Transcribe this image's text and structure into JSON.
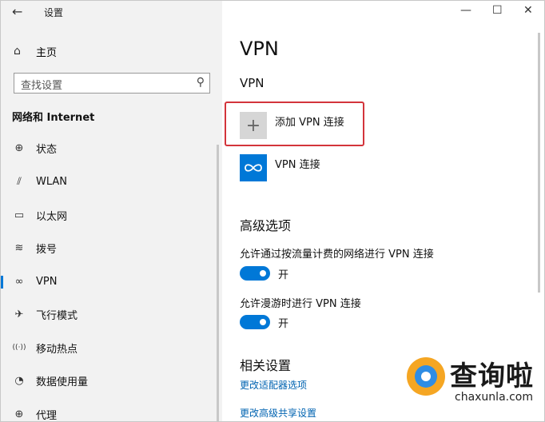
{
  "window": {
    "title": "设置",
    "back_glyph": "←",
    "minimize_glyph": "—",
    "maximize_glyph": "☐",
    "close_glyph": "✕"
  },
  "sidebar": {
    "home_label": "主页",
    "search_placeholder": "查找设置",
    "section_title": "网络和 Internet",
    "items": [
      {
        "label": "状态",
        "icon": "globe-icon",
        "glyph": "⊕"
      },
      {
        "label": "WLAN",
        "icon": "wifi-icon",
        "glyph": "⫽"
      },
      {
        "label": "以太网",
        "icon": "ethernet-icon",
        "glyph": "▭"
      },
      {
        "label": "拨号",
        "icon": "dialup-icon",
        "glyph": "≋"
      },
      {
        "label": "VPN",
        "icon": "vpn-icon",
        "glyph": "∞",
        "active": true
      },
      {
        "label": "飞行模式",
        "icon": "airplane-icon",
        "glyph": "✈"
      },
      {
        "label": "移动热点",
        "icon": "hotspot-icon",
        "glyph": "((·))"
      },
      {
        "label": "数据使用量",
        "icon": "data-usage-icon",
        "glyph": "◔"
      },
      {
        "label": "代理",
        "icon": "proxy-icon",
        "glyph": "⊕"
      }
    ]
  },
  "main": {
    "page_title": "VPN",
    "vpn_section_title": "VPN",
    "add_vpn_label": "添加 VPN 连接",
    "vpn_connection_label": "VPN 连接",
    "advanced_title": "高级选项",
    "option1_label": "允许通过按流量计费的网络进行 VPN 连接",
    "option1_state": "开",
    "option2_label": "允许漫游时进行 VPN 连接",
    "option2_state": "开",
    "related_title": "相关设置",
    "link1": "更改适配器选项",
    "link2": "更改高级共享设置"
  },
  "watermark": {
    "text": "查询啦",
    "sub": "chaxunla.com"
  },
  "colors": {
    "accent": "#0078d7",
    "highlight_border": "#d3343b",
    "sidebar_bg": "#f2f2f2"
  }
}
